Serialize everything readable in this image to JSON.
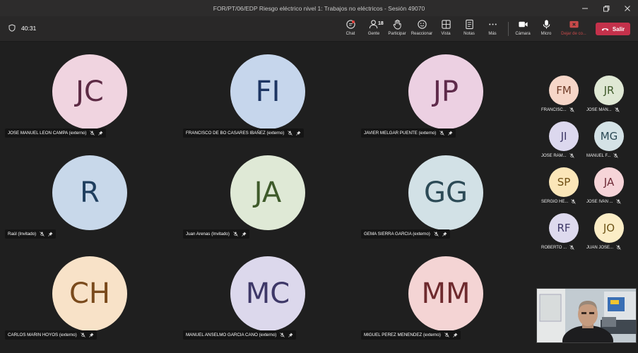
{
  "window": {
    "title": "FOR/PT/06/EDP Riesgo eléctrico nivel 1: Trabajos no eléctricos - Sesión 49070"
  },
  "toolbar": {
    "timer": "40:31",
    "chat": "Chat",
    "people": "Gente",
    "people_count": "18",
    "raise": "Participar",
    "react": "Reaccionar",
    "view": "Vista",
    "notes": "Notas",
    "more": "Más",
    "camera": "Cámara",
    "mic": "Micro",
    "share": "Dejar de co...",
    "leave": "Salir"
  },
  "tiles": [
    {
      "initials": "JC",
      "name": "JOSE MANUEL LEON CAMPA (externo)",
      "bg": "#f0d4e0",
      "fg": "#5c2a44"
    },
    {
      "initials": "FI",
      "name": "FRANCISCO DE BO CASARES IBAÑEZ (externo)",
      "bg": "#c6d6ec",
      "fg": "#1d3563"
    },
    {
      "initials": "JP",
      "name": "JAVIER MELGAR PUENTE (externo)",
      "bg": "#ecd0e2",
      "fg": "#5e2a4a"
    },
    {
      "initials": "R",
      "name": "Raúl (Invitado)",
      "bg": "#c8d8ea",
      "fg": "#1f3e5e"
    },
    {
      "initials": "JA",
      "name": "Juan Arenas (Invitado)",
      "bg": "#dfe9d6",
      "fg": "#3e5a2a"
    },
    {
      "initials": "GG",
      "name": "GEMA SIERRA GARCIA (externo)",
      "bg": "#d2e1e6",
      "fg": "#2c4a56"
    },
    {
      "initials": "CH",
      "name": "CARLOS MARIN HOYOS (externo)",
      "bg": "#f8e2c8",
      "fg": "#7a4a1c"
    },
    {
      "initials": "MC",
      "name": "MANUEL ANSELMO GARCIA CANO (externo)",
      "bg": "#dcd8ec",
      "fg": "#3e3868"
    },
    {
      "initials": "MM",
      "name": "MIGUEL PEREZ MENENDEZ (externo)",
      "bg": "#f4d4d4",
      "fg": "#6e2a2e"
    }
  ],
  "side": [
    {
      "initials": "FM",
      "name": "FRANCISC...",
      "bg": "#f6d6c8",
      "fg": "#6e3a26"
    },
    {
      "initials": "JR",
      "name": "JOSE MAN...",
      "bg": "#dfe8d4",
      "fg": "#3e5a2a"
    },
    {
      "initials": "JI",
      "name": "JOSE RAM...",
      "bg": "#dcd8ee",
      "fg": "#3e3868"
    },
    {
      "initials": "MG",
      "name": "MANUEL F...",
      "bg": "#d4e2e6",
      "fg": "#2c4a56"
    },
    {
      "initials": "SP",
      "name": "SERGIO HE...",
      "bg": "#fbe6b8",
      "fg": "#6e4e12"
    },
    {
      "initials": "JA",
      "name": "JOSE IVAN ...",
      "bg": "#f6d4d8",
      "fg": "#6e2a36"
    },
    {
      "initials": "RF",
      "name": "ROBERTO ...",
      "bg": "#dedaee",
      "fg": "#3e3868"
    },
    {
      "initials": "JO",
      "name": "JUAN JOSE...",
      "bg": "#fbedc6",
      "fg": "#6e5418"
    }
  ]
}
